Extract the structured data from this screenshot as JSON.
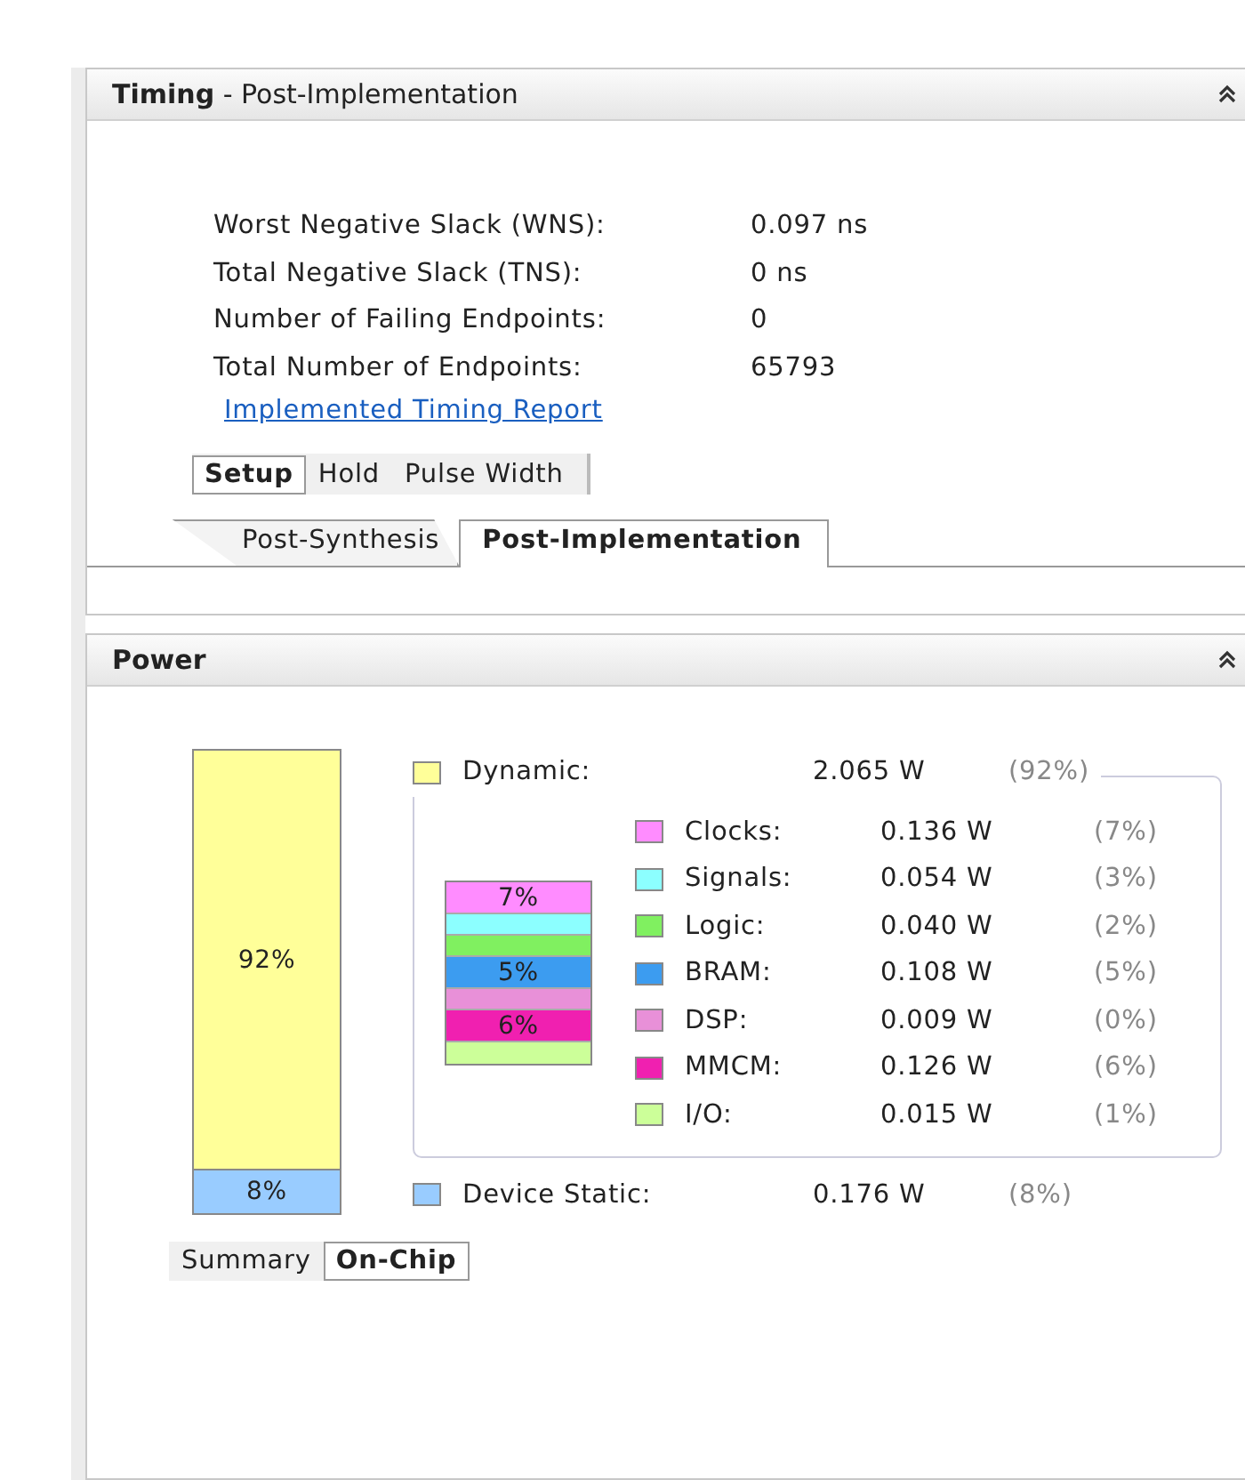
{
  "timing": {
    "title": "**Timing** - Post-Implementation",
    "metrics": [
      {
        "label": "Worst Negative Slack (WNS):",
        "value": "0.097 ns"
      },
      {
        "label": "Total Negative Slack (TNS):",
        "value": "0 ns"
      },
      {
        "label": "Number of Failing Endpoints:",
        "value": "0"
      },
      {
        "label": "Total Number of Endpoints:",
        "value": "65793"
      }
    ],
    "report_link": "Implemented Timing Report",
    "check_tabs": [
      {
        "label": "Setup",
        "selected": true
      },
      {
        "label": "Hold",
        "selected": false
      },
      {
        "label": "Pulse Width",
        "selected": false
      }
    ],
    "stage_tabs": [
      {
        "label": "Post-Synthesis",
        "selected": false
      },
      {
        "label": "Post-Implementation",
        "selected": true
      }
    ]
  },
  "power": {
    "title": "Power",
    "dynamic": {
      "label": "Dynamic:",
      "value": "2.065 W",
      "percent": "(92%)",
      "color": "#ffff99",
      "bar_label": "92%"
    },
    "components": [
      {
        "label": "Clocks:",
        "value": "0.136 W",
        "percent": "(7%)",
        "color": "#ff8cff",
        "bar_label": "7%"
      },
      {
        "label": "Signals:",
        "value": "0.054 W",
        "percent": "(3%)",
        "color": "#8cffff"
      },
      {
        "label": "Logic:",
        "value": "0.040 W",
        "percent": "(2%)",
        "color": "#80f060"
      },
      {
        "label": "BRAM:",
        "value": "0.108 W",
        "percent": "(5%)",
        "color": "#3c9cf0",
        "bar_label": "5%"
      },
      {
        "label": "DSP:",
        "value": "0.009 W",
        "percent": "(0%)",
        "color": "#e890d8"
      },
      {
        "label": "MMCM:",
        "value": "0.126 W",
        "percent": "(6%)",
        "color": "#f020b0",
        "bar_label": "6%"
      },
      {
        "label": "I/O:",
        "value": "0.015 W",
        "percent": "(1%)",
        "color": "#ccff99"
      }
    ],
    "static": {
      "label": "Device Static:",
      "value": "0.176 W",
      "percent": "(8%)",
      "color": "#99ccff",
      "bar_label": "8%"
    },
    "view_tabs": [
      {
        "label": "Summary",
        "selected": false
      },
      {
        "label": "On-Chip",
        "selected": true
      }
    ]
  }
}
